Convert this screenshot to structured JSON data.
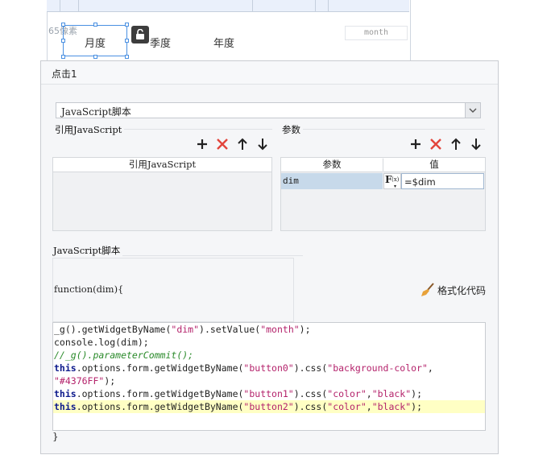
{
  "designer": {
    "pixel_label": "65像素",
    "tabs": [
      "月度",
      "季度",
      "年度"
    ],
    "month_placeholder": "month"
  },
  "dialog": {
    "title": "点击1",
    "script_type": "JavaScript脚本",
    "ref_js_section": "引用JavaScript",
    "params_section": "参数",
    "ref_js_column": "引用JavaScript",
    "params_columns": [
      "参数",
      "值"
    ],
    "param_rows": [
      {
        "name": "dim",
        "value": "=$dim"
      }
    ],
    "script_section": "JavaScript脚本",
    "function_signature": "function(dim){",
    "format_button": "格式化代码",
    "closing_brace": "}",
    "code_lines": [
      "_g().getWidgetByName(\"dim\").setValue(\"month\");",
      "console.log(dim);",
      "//_g().parameterCommit();",
      "this.options.form.getWidgetByName(\"button0\").css(\"background-color\",",
      "\"#4376FF\");",
      "this.options.form.getWidgetByName(\"button1\").css(\"color\",\"black\");",
      "this.options.form.getWidgetByName(\"button2\").css(\"color\",\"black\");"
    ]
  },
  "icons": {
    "add": "plus-icon",
    "delete": "delete-x-icon",
    "up": "arrow-up-icon",
    "down": "arrow-down-icon",
    "lock": "unlock-icon",
    "format": "broom-icon",
    "formula": "fx-icon"
  },
  "colors": {
    "accent_blue": "#4a90e2",
    "delete_red": "#e2453c",
    "selected_row": "#c7d9ea",
    "highlight_line": "#ffffc4"
  }
}
